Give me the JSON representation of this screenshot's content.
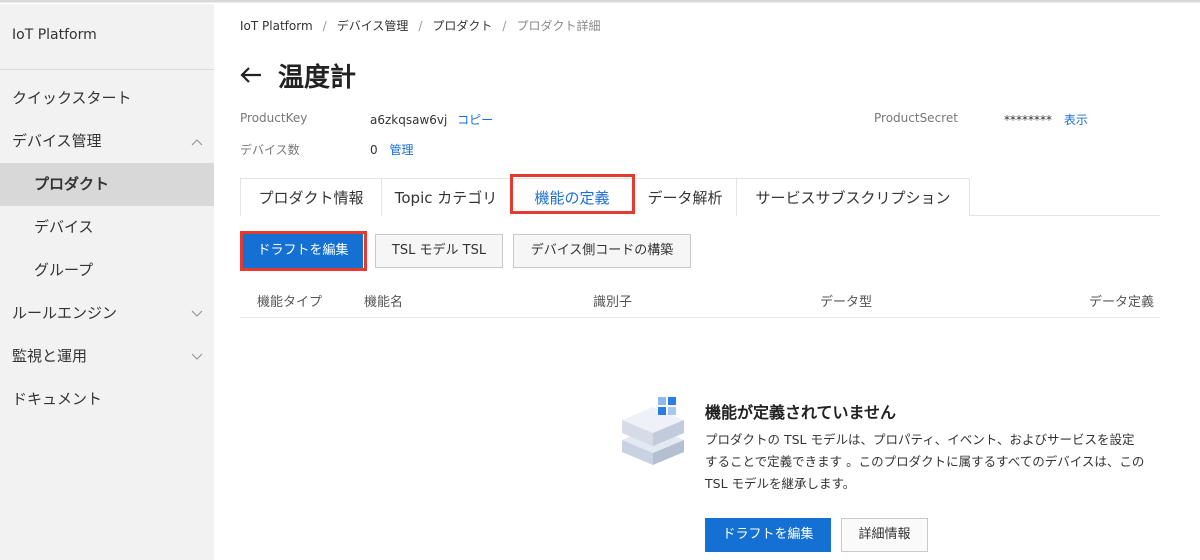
{
  "app": {
    "brand": "IoT Platform"
  },
  "sidebar": {
    "items": [
      {
        "label": "クイックスタート"
      },
      {
        "label": "デバイス管理"
      },
      {
        "label": "プロダクト"
      },
      {
        "label": "デバイス"
      },
      {
        "label": "グループ"
      },
      {
        "label": "ルールエンジン"
      },
      {
        "label": "監視と運用"
      },
      {
        "label": "ドキュメント"
      }
    ]
  },
  "breadcrumb": [
    "IoT Platform",
    "デバイス管理",
    "プロダクト",
    "プロダクト詳細"
  ],
  "page": {
    "title": "温度計"
  },
  "product": {
    "key_label": "ProductKey",
    "key_value": "a6zkqsaw6vj",
    "copy_link": "コピー",
    "device_count_label": "デバイス数",
    "device_count_value": "0",
    "manage_link": "管理",
    "secret_label": "ProductSecret",
    "secret_value": "********",
    "show_link": "表示"
  },
  "tabs": [
    {
      "label": "プロダクト情報"
    },
    {
      "label": "Topic カテゴリ"
    },
    {
      "label": "機能の定義"
    },
    {
      "label": "データ解析"
    },
    {
      "label": "サービスサブスクリプション"
    }
  ],
  "active_tab": "機能の定義",
  "toolbar": {
    "edit_draft": "ドラフトを編集",
    "tsl_model": "TSL モデル TSL",
    "device_code": "デバイス側コードの構築"
  },
  "table": {
    "columns": [
      "機能タイプ",
      "機能名",
      "識別子",
      "データ型",
      "データ定義"
    ]
  },
  "empty_state": {
    "title": "機能が定義されていません",
    "description": "プロダクトの TSL モデルは、プロパティ、イベント、およびサービスを設定することで定義できます 。このプロダクトに属するすべてのデバイスは、この TSL モデルを継承します。",
    "primary_button": "ドラフトを編集",
    "secondary_button": "詳細情報"
  },
  "colors": {
    "accent": "#1570d3",
    "link": "#1a6fd6",
    "highlight": "#e53a2f",
    "sidebar_bg": "#f2f2f2"
  }
}
